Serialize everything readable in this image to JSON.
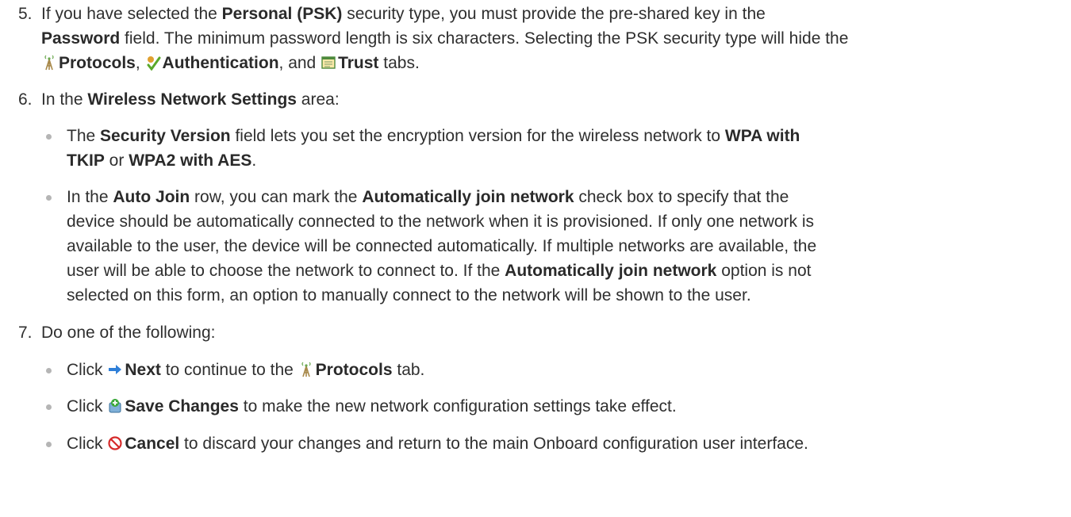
{
  "step5": {
    "number": "5.",
    "t1": "If you have selected the ",
    "b1": "Personal (PSK)",
    "t2": " security type, you must provide the pre-shared key in the",
    "b2": "Password",
    "t3": " field. The minimum password length is six characters. Selecting the PSK security type will hide the",
    "b3": "Protocols",
    "t4": ", ",
    "b4": "Authentication",
    "t5": ", and ",
    "b5": "Trust",
    "t6": " tabs.",
    "icons": [
      "protocols-icon",
      "authentication-icon",
      "trust-icon"
    ]
  },
  "step6": {
    "number": "6.",
    "t1": "In the ",
    "b1": "Wireless Network Settings",
    "t2": " area:",
    "bullet1": {
      "t1": "The ",
      "b1": "Security Version",
      "t2": " field lets you set the encryption version for the wireless network to ",
      "b2": "WPA with",
      "b3": "TKIP",
      "t3": " or ",
      "b4": "WPA2 with AES",
      "t4": "."
    },
    "bullet2": {
      "t1": "In the ",
      "b1": "Auto Join",
      "t2": " row, you can mark the ",
      "b2": "Automatically join network",
      "t3": " check box to specify that the",
      "t4": "device should be automatically connected to the network when it is provisioned. If only one network is",
      "t5": "available to the user, the device will be connected automatically. If multiple networks are available, the",
      "t6": "user will be able to choose the network to connect to. If the ",
      "b3": "Automatically join network",
      "t7": " option is not",
      "t8": "selected on this form, an option to manually connect to the network will be shown to the user."
    }
  },
  "step7": {
    "number": "7.",
    "text": "Do one of the following:",
    "next": {
      "t1": "Click ",
      "b1": "Next",
      "t2": " to continue to the ",
      "b2": "Protocols",
      "t3": " tab."
    },
    "save": {
      "t1": "Click ",
      "b1": "Save Changes",
      "t2": " to make the new network configuration settings take effect."
    },
    "cancel": {
      "t1": "Click ",
      "b1": "Cancel",
      "t2": " to discard your changes and return to the main Onboard configuration user interface."
    },
    "icons": [
      "next-arrow-icon",
      "protocols-icon",
      "save-icon",
      "cancel-icon"
    ]
  },
  "colors": {
    "text": "#2f2f2f",
    "bullet": "#b5b5b5",
    "next_arrow": "#2f7fd8",
    "save_green": "#3aa83a",
    "cancel_red": "#d62b2b"
  }
}
